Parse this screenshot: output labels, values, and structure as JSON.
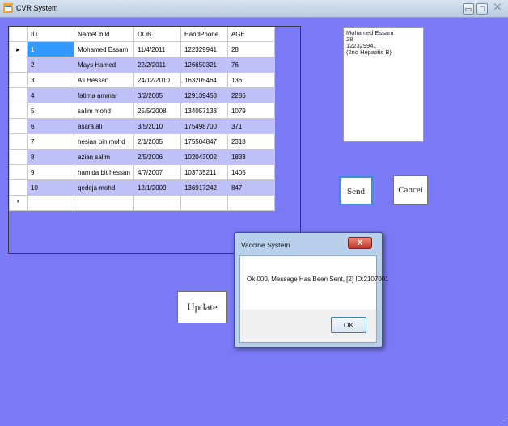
{
  "window": {
    "title": "CVR System",
    "ghost_title": "Children Vaccination Reminder System",
    "minimize_glyph": "▭",
    "maximize_glyph": "□",
    "close_glyph": "⨉",
    "icon": "app-window-icon"
  },
  "grid": {
    "columns": [
      "ID",
      "NameChild",
      "DOB",
      "HandPhone",
      "AGE"
    ],
    "current_row_glyph": "▸",
    "new_row_glyph": "*",
    "rows": [
      {
        "id": "1",
        "name": "Mohamed Essam",
        "dob": "11/4/2011",
        "phone": "122329941",
        "age": "28"
      },
      {
        "id": "2",
        "name": "Mays Hamed",
        "dob": "22/2/2011",
        "phone": "126650321",
        "age": "76"
      },
      {
        "id": "3",
        "name": "Ali Hessan",
        "dob": "24/12/2010",
        "phone": "163205464",
        "age": "136"
      },
      {
        "id": "4",
        "name": "fatima ammar",
        "dob": "3/2/2005",
        "phone": "129139458",
        "age": "2286"
      },
      {
        "id": "5",
        "name": "salim mohd",
        "dob": "25/5/2008",
        "phone": "134057133",
        "age": "1079"
      },
      {
        "id": "6",
        "name": "asara ali",
        "dob": "3/5/2010",
        "phone": "175498700",
        "age": "371"
      },
      {
        "id": "7",
        "name": "hesian bin mohd",
        "dob": "2/1/2005",
        "phone": "175504847",
        "age": "2318"
      },
      {
        "id": "8",
        "name": "azian salim",
        "dob": "2/5/2006",
        "phone": "102043002",
        "age": "1833"
      },
      {
        "id": "9",
        "name": "hamida bit hessan",
        "dob": "4/7/2007",
        "phone": "103735211",
        "age": "1405"
      },
      {
        "id": "10",
        "name": "qedeja mohd",
        "dob": "12/1/2009",
        "phone": "136917242",
        "age": "847"
      }
    ]
  },
  "info": {
    "lines": [
      "Mohamed Essam",
      "28",
      "122329941",
      "(2nd Hepatitis B)"
    ]
  },
  "buttons": {
    "send": "Send",
    "cancel": "Cancel",
    "update": "Update"
  },
  "dialog": {
    "title": "Vaccine System",
    "close_glyph": "X",
    "message": "Ok 000, Message Has Been Sent, [2] ID:2107001",
    "ok": "OK"
  },
  "colors": {
    "client_bg": "#7a7af6",
    "alt_row": "#c0c0f8",
    "selection": "#3399ff"
  }
}
